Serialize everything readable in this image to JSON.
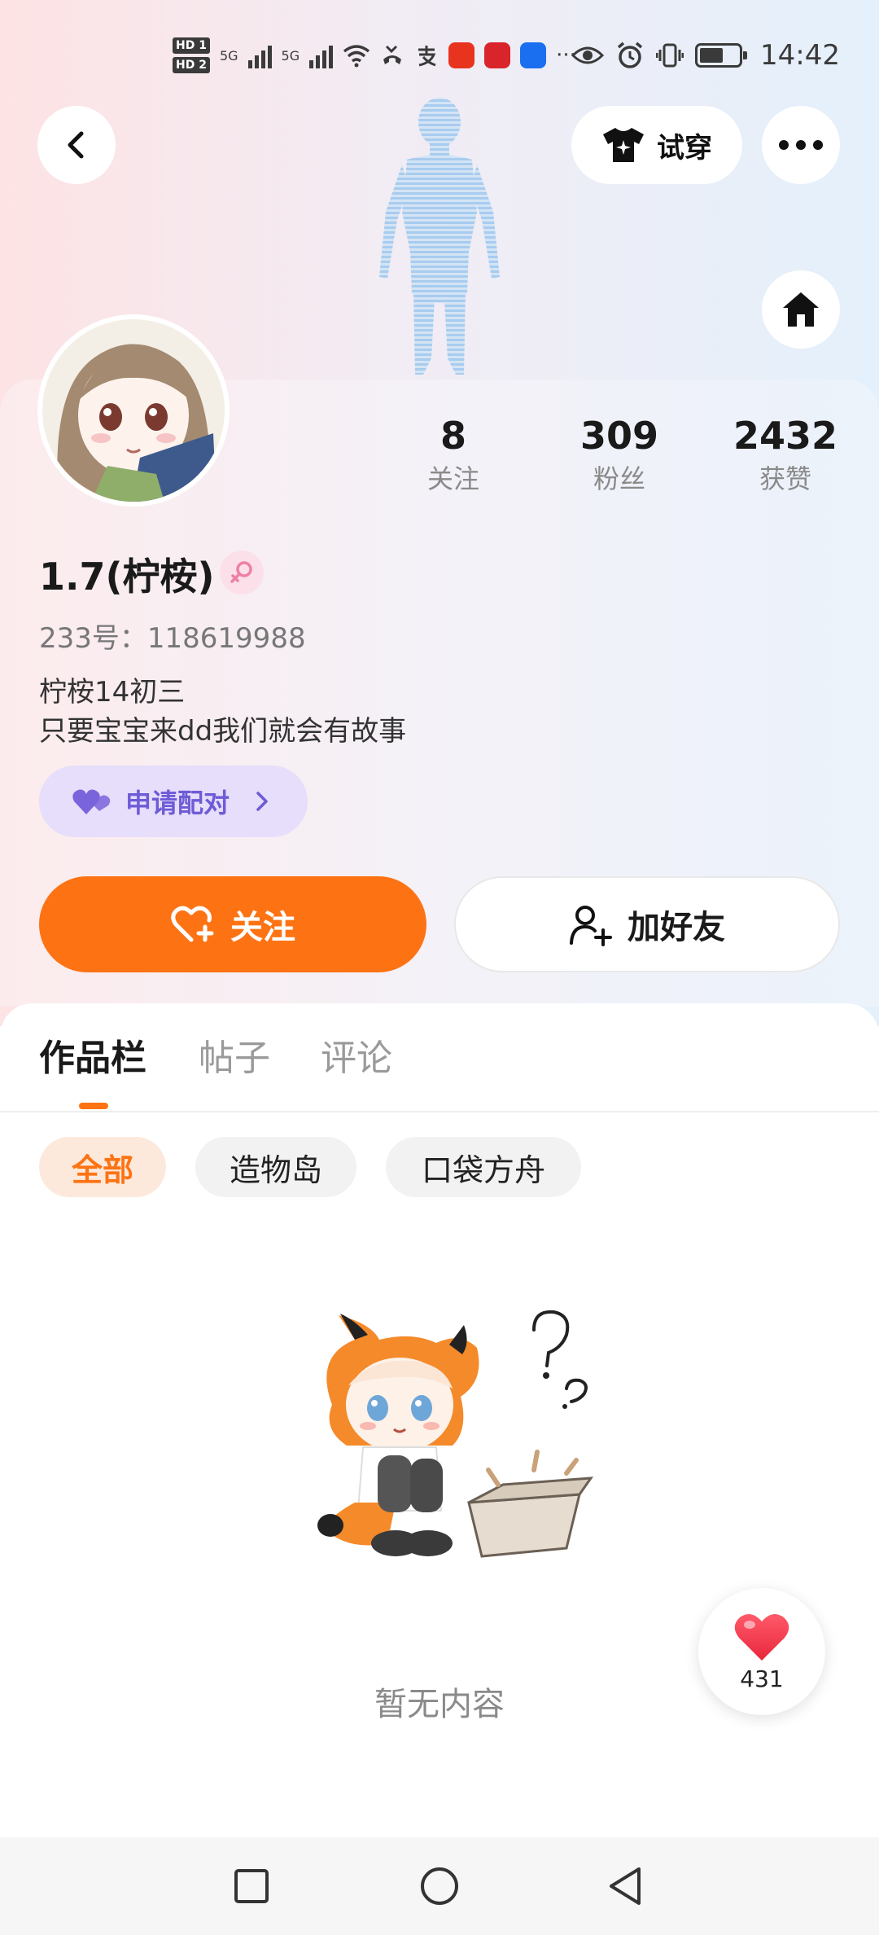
{
  "status_bar": {
    "hd1": "HD 1",
    "hd2": "HD 2",
    "net1": "5G",
    "net2": "5G",
    "more": "···",
    "time": "14:42"
  },
  "header": {
    "try_on_label": "试穿"
  },
  "profile": {
    "name": "1.7(柠桉)",
    "gender": "female",
    "id_line": "233号：118619988",
    "bio_line1": "柠桉14初三",
    "bio_line2": "只要宝宝来dd我们就会有故事",
    "stats": [
      {
        "value": "8",
        "label": "关注"
      },
      {
        "value": "309",
        "label": "粉丝"
      },
      {
        "value": "2432",
        "label": "获赞"
      }
    ],
    "pair_label": "申请配对",
    "follow_label": "关注",
    "add_friend_label": "加好友"
  },
  "tabs": [
    {
      "label": "作品栏",
      "active": true
    },
    {
      "label": "帖子",
      "active": false
    },
    {
      "label": "评论",
      "active": false
    }
  ],
  "chips": [
    {
      "label": "全部",
      "active": true
    },
    {
      "label": "造物岛",
      "active": false
    },
    {
      "label": "口袋方舟",
      "active": false
    }
  ],
  "empty_state": {
    "text": "暂无内容"
  },
  "like_float": {
    "count": "431"
  },
  "colors": {
    "accent": "#fd7314",
    "pair_text": "#6e5bd6",
    "pair_bg": "#e6defa"
  }
}
